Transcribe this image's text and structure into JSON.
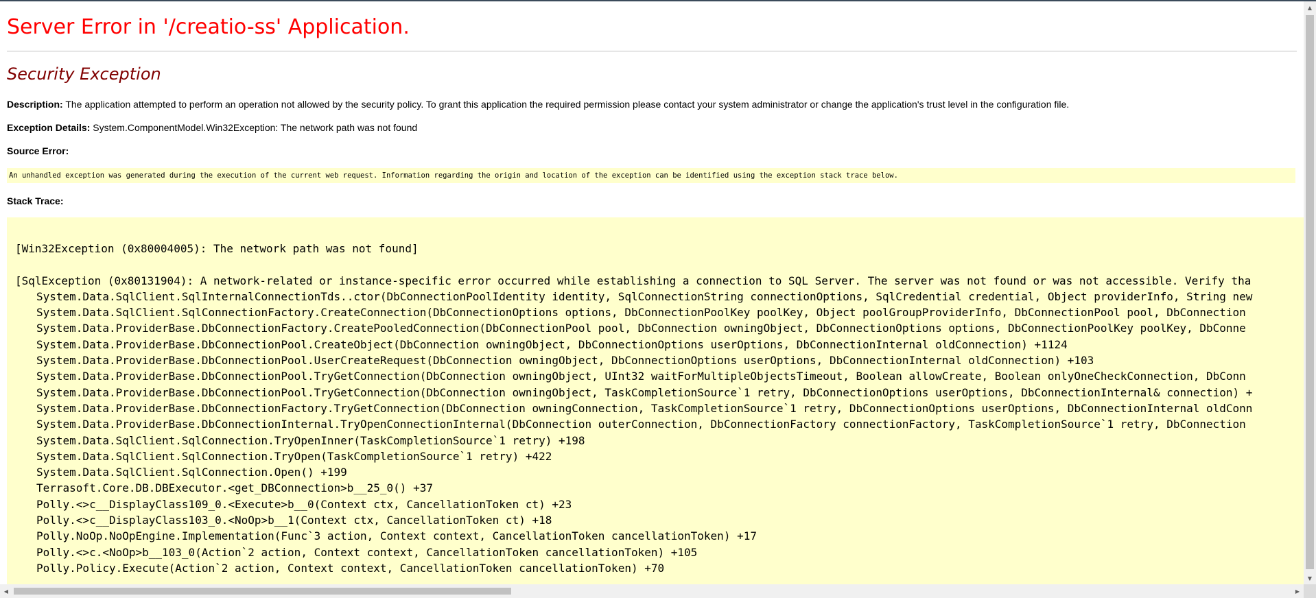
{
  "page": {
    "title": "Server Error in '/creatio-ss' Application.",
    "exception_title": "Security Exception"
  },
  "description": {
    "label": "Description:",
    "text": "The application attempted to perform an operation not allowed by the security policy.  To grant this application the required permission please contact your system administrator or change the application's trust level in the configuration file."
  },
  "exception_details": {
    "label": "Exception Details:",
    "text": "System.ComponentModel.Win32Exception: The network path was not found"
  },
  "source_error": {
    "label": "Source Error:",
    "text": "An unhandled exception was generated during the execution of the current web request. Information regarding the origin and location of the exception can be identified using the exception stack trace below."
  },
  "stack_trace": {
    "label": "Stack Trace:",
    "lines": [
      {
        "text": "[Win32Exception (0x80004005): The network path was not found]",
        "frame": false
      },
      {
        "text": "",
        "frame": false
      },
      {
        "text": "[SqlException (0x80131904): A network-related or instance-specific error occurred while establishing a connection to SQL Server. The server was not found or was not accessible. Verify tha",
        "frame": false
      },
      {
        "text": "System.Data.SqlClient.SqlInternalConnectionTds..ctor(DbConnectionPoolIdentity identity, SqlConnectionString connectionOptions, SqlCredential credential, Object providerInfo, String new",
        "frame": true
      },
      {
        "text": "System.Data.SqlClient.SqlConnectionFactory.CreateConnection(DbConnectionOptions options, DbConnectionPoolKey poolKey, Object poolGroupProviderInfo, DbConnectionPool pool, DbConnection",
        "frame": true
      },
      {
        "text": "System.Data.ProviderBase.DbConnectionFactory.CreatePooledConnection(DbConnectionPool pool, DbConnection owningObject, DbConnectionOptions options, DbConnectionPoolKey poolKey, DbConne",
        "frame": true
      },
      {
        "text": "System.Data.ProviderBase.DbConnectionPool.CreateObject(DbConnection owningObject, DbConnectionOptions userOptions, DbConnectionInternal oldConnection) +1124",
        "frame": true
      },
      {
        "text": "System.Data.ProviderBase.DbConnectionPool.UserCreateRequest(DbConnection owningObject, DbConnectionOptions userOptions, DbConnectionInternal oldConnection) +103",
        "frame": true
      },
      {
        "text": "System.Data.ProviderBase.DbConnectionPool.TryGetConnection(DbConnection owningObject, UInt32 waitForMultipleObjectsTimeout, Boolean allowCreate, Boolean onlyOneCheckConnection, DbConn",
        "frame": true
      },
      {
        "text": "System.Data.ProviderBase.DbConnectionPool.TryGetConnection(DbConnection owningObject, TaskCompletionSource`1 retry, DbConnectionOptions userOptions, DbConnectionInternal& connection) +",
        "frame": true
      },
      {
        "text": "System.Data.ProviderBase.DbConnectionFactory.TryGetConnection(DbConnection owningConnection, TaskCompletionSource`1 retry, DbConnectionOptions userOptions, DbConnectionInternal oldConn",
        "frame": true
      },
      {
        "text": "System.Data.ProviderBase.DbConnectionInternal.TryOpenConnectionInternal(DbConnection outerConnection, DbConnectionFactory connectionFactory, TaskCompletionSource`1 retry, DbConnection",
        "frame": true
      },
      {
        "text": "System.Data.SqlClient.SqlConnection.TryOpenInner(TaskCompletionSource`1 retry) +198",
        "frame": true
      },
      {
        "text": "System.Data.SqlClient.SqlConnection.TryOpen(TaskCompletionSource`1 retry) +422",
        "frame": true
      },
      {
        "text": "System.Data.SqlClient.SqlConnection.Open() +199",
        "frame": true
      },
      {
        "text": "Terrasoft.Core.DB.DBExecutor.<get_DBConnection>b__25_0() +37",
        "frame": true
      },
      {
        "text": "Polly.<>c__DisplayClass109_0.<Execute>b__0(Context ctx, CancellationToken ct) +23",
        "frame": true
      },
      {
        "text": "Polly.<>c__DisplayClass103_0.<NoOp>b__1(Context ctx, CancellationToken ct) +18",
        "frame": true
      },
      {
        "text": "Polly.NoOp.NoOpEngine.Implementation(Func`3 action, Context context, CancellationToken cancellationToken) +17",
        "frame": true
      },
      {
        "text": "Polly.<>c.<NoOp>b__103_0(Action`2 action, Context context, CancellationToken cancellationToken) +105",
        "frame": true
      },
      {
        "text": "Polly.Policy.Execute(Action`2 action, Context context, CancellationToken cancellationToken) +70",
        "frame": true
      }
    ]
  },
  "scrollbars": {
    "up_arrow": "▲",
    "down_arrow": "▼",
    "left_arrow": "◀",
    "right_arrow": "▶"
  },
  "colors": {
    "title_red": "#ff0000",
    "exception_maroon": "#800000",
    "code_background": "#ffffcc"
  }
}
